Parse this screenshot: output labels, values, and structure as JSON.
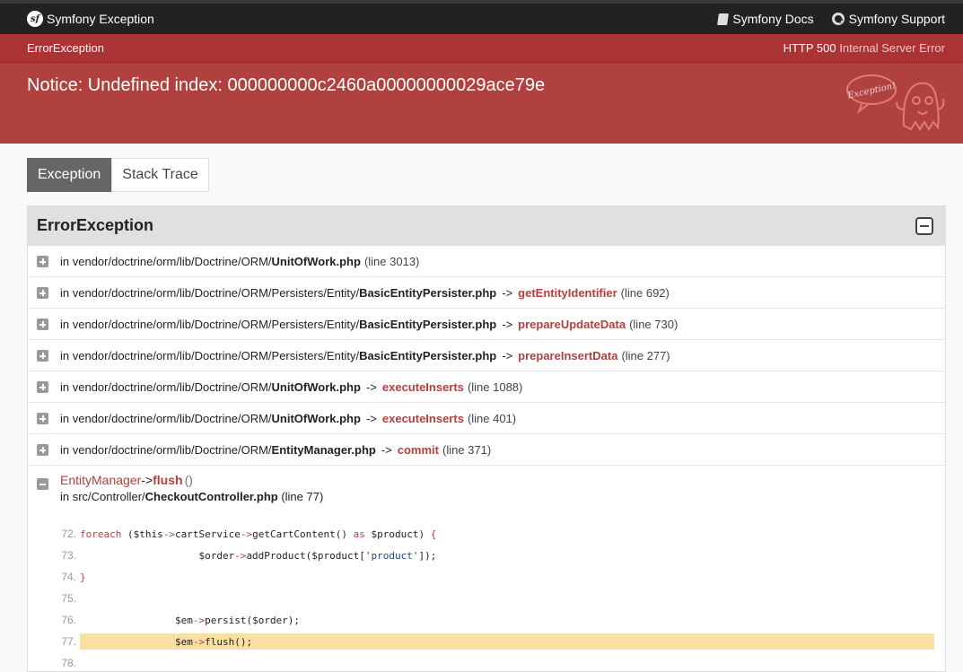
{
  "topbar": {
    "brand_logo": "sf",
    "brand_title": "Symfony Exception",
    "docs_label": "Symfony Docs",
    "support_label": "Symfony Support"
  },
  "exception_bar": {
    "class_name": "ErrorException",
    "status_code": "HTTP 500",
    "status_text": "Internal Server Error"
  },
  "header": {
    "message": "Notice: Undefined index: 000000000c2460a00000000029ace79e",
    "badge_text": "Exception!"
  },
  "tabs": [
    {
      "label": "Exception",
      "active": true
    },
    {
      "label": "Stack Trace",
      "active": false
    }
  ],
  "trace": {
    "title": "ErrorException",
    "rows": [
      {
        "prefix": "in vendor/doctrine/orm/lib/Doctrine/ORM/",
        "file": "UnitOfWork.php",
        "arrow": "",
        "func": "",
        "line": "(line 3013)"
      },
      {
        "prefix": "in vendor/doctrine/orm/lib/Doctrine/ORM/Persisters/Entity/",
        "file": "BasicEntityPersister.php",
        "arrow": "->",
        "func": "getEntityIdentifier",
        "line": "(line 692)"
      },
      {
        "prefix": "in vendor/doctrine/orm/lib/Doctrine/ORM/Persisters/Entity/",
        "file": "BasicEntityPersister.php",
        "arrow": "->",
        "func": "prepareUpdateData",
        "line": "(line 730)"
      },
      {
        "prefix": "in vendor/doctrine/orm/lib/Doctrine/ORM/Persisters/Entity/",
        "file": "BasicEntityPersister.php",
        "arrow": "->",
        "func": "prepareInsertData",
        "line": "(line 277)"
      },
      {
        "prefix": "in vendor/doctrine/orm/lib/Doctrine/ORM/",
        "file": "UnitOfWork.php",
        "arrow": "->",
        "func": "executeInserts",
        "line": "(line 1088)"
      },
      {
        "prefix": "in vendor/doctrine/orm/lib/Doctrine/ORM/",
        "file": "UnitOfWork.php",
        "arrow": "->",
        "func": "executeInserts",
        "line": "(line 401)"
      },
      {
        "prefix": "in vendor/doctrine/orm/lib/Doctrine/ORM/",
        "file": "EntityManager.php",
        "arrow": "->",
        "func": "commit",
        "line": "(line 371)"
      }
    ],
    "expanded": {
      "class": "EntityManager",
      "arrow": "->",
      "method": "flush",
      "parens": "()",
      "loc_prefix": "in src/Controller/",
      "loc_file": "CheckoutController.php",
      "loc_line": "(line 77)",
      "code": [
        {
          "num": "72."
        },
        {
          "num": "73."
        },
        {
          "num": "74."
        },
        {
          "num": "75."
        },
        {
          "num": "76."
        },
        {
          "num": "77."
        },
        {
          "num": "78."
        }
      ]
    }
  }
}
